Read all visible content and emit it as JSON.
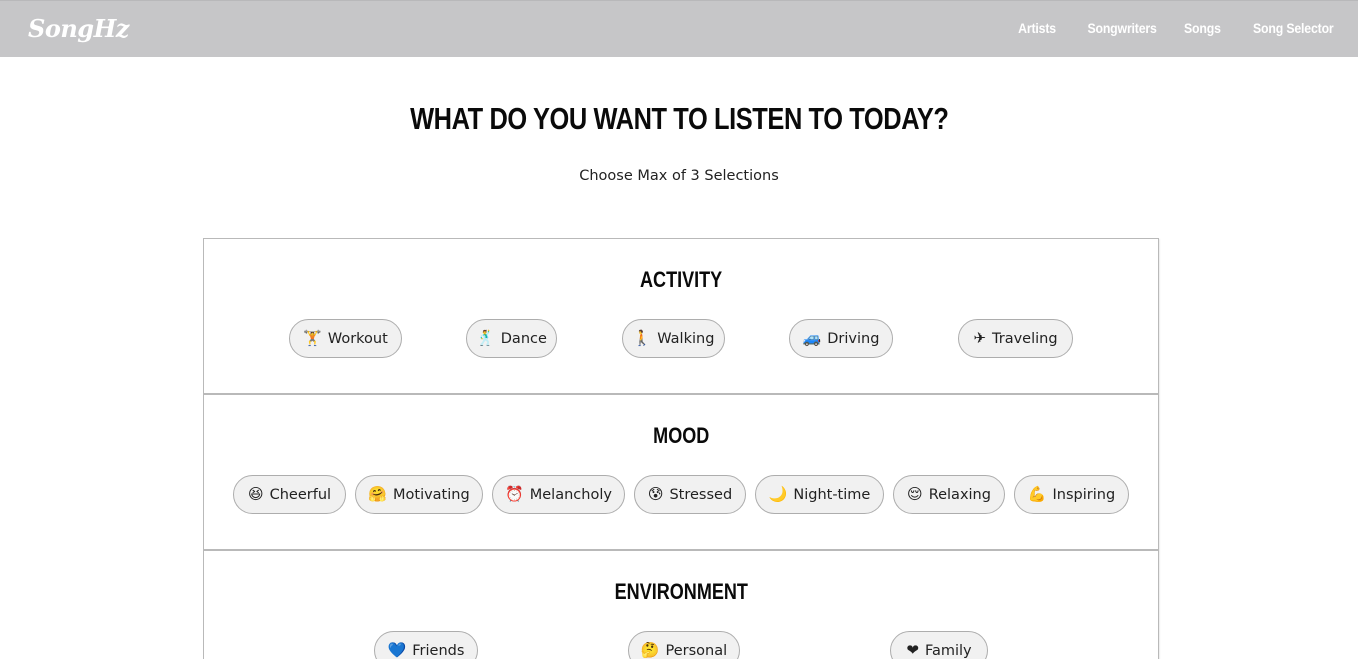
{
  "header": {
    "logo": "SongHz",
    "nav": [
      "Artists",
      "Songwriters",
      "Songs",
      "Song Selector"
    ]
  },
  "main": {
    "title": "WHAT DO YOU WANT TO LISTEN TO TODAY?",
    "subtitle": "Choose Max of 3 Selections"
  },
  "sections": [
    {
      "title": "ACTIVITY",
      "options": [
        {
          "label": "Workout",
          "icon": "weightlifter-icon",
          "glyph": "🏋"
        },
        {
          "label": "Dance",
          "icon": "dancer-icon",
          "glyph": "🕺"
        },
        {
          "label": "Walking",
          "icon": "walking-person-icon",
          "glyph": "🚶"
        },
        {
          "label": "Driving",
          "icon": "car-icon",
          "glyph": "🚙"
        },
        {
          "label": "Traveling",
          "icon": "airplane-icon",
          "glyph": "✈"
        }
      ]
    },
    {
      "title": "MOOD",
      "options": [
        {
          "label": "Cheerful",
          "icon": "laughing-face-icon",
          "glyph": "😆"
        },
        {
          "label": "Motivating",
          "icon": "hugging-face-icon",
          "glyph": "🤗"
        },
        {
          "label": "Melancholy",
          "icon": "alarm-clock-icon",
          "glyph": "⏰"
        },
        {
          "label": "Stressed",
          "icon": "anxious-face-icon",
          "glyph": "😰"
        },
        {
          "label": "Night-time",
          "icon": "crescent-moon-icon",
          "glyph": "🌙"
        },
        {
          "label": "Relaxing",
          "icon": "relieved-face-icon",
          "glyph": "😌"
        },
        {
          "label": "Inspiring",
          "icon": "flexed-biceps-icon",
          "glyph": "💪"
        }
      ]
    },
    {
      "title": "ENVIRONMENT",
      "options": [
        {
          "label": "Friends",
          "icon": "blue-heart-icon",
          "glyph": "💙"
        },
        {
          "label": "Personal",
          "icon": "thinking-face-icon",
          "glyph": "🤔"
        },
        {
          "label": "Family",
          "icon": "red-heart-icon",
          "glyph": "❤"
        }
      ]
    }
  ]
}
